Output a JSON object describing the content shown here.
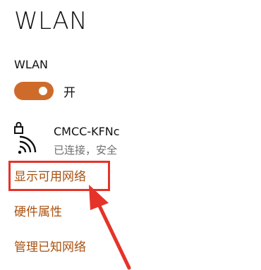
{
  "page": {
    "title": "WLAN"
  },
  "wlan": {
    "label": "WLAN",
    "toggle_on": true,
    "toggle_state_label": "开",
    "accent_color": "#cf6b2a"
  },
  "network": {
    "name": "CMCC-KFNc",
    "status": "已连接，安全",
    "icon": "wifi-secured-icon"
  },
  "links": {
    "show_networks": "显示可用网络",
    "hardware_properties": "硬件属性",
    "manage_known_networks": "管理已知网络"
  },
  "annotation": {
    "box_color": "#e53329",
    "arrow_color": "#e53329"
  }
}
